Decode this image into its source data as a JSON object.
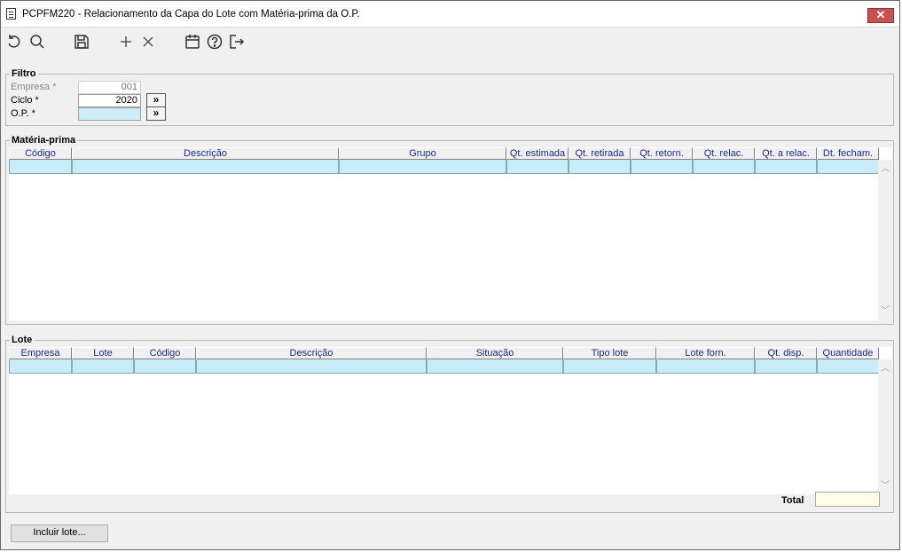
{
  "window": {
    "title": "PCPFM220 - Relacionamento da Capa do Lote com Matéria-prima da O.P.",
    "close_glyph": "✕"
  },
  "toolbar": {
    "icons": [
      "undo-icon",
      "search-icon",
      "save-icon",
      "add-icon",
      "delete-icon",
      "calendar-icon",
      "help-icon",
      "exit-icon"
    ]
  },
  "filtro": {
    "legend": "Filtro",
    "empresa_label": "Empresa *",
    "empresa_value": "001",
    "ciclo_label": "Ciclo *",
    "ciclo_value": "2020",
    "op_label": "O.P. *",
    "op_value": "",
    "zoom_glyph": "»"
  },
  "materia_prima": {
    "legend": "Matéria-prima",
    "columns": [
      "Código",
      "Descrição",
      "Grupo",
      "Qt. estimada",
      "Qt. retirada",
      "Qt. retorn.",
      "Qt. relac.",
      "Qt. a relac.",
      "Dt. fecham."
    ]
  },
  "lote": {
    "legend": "Lote",
    "columns": [
      "Empresa",
      "Lote",
      "Código",
      "Descrição",
      "Situação",
      "Tipo lote",
      "Lote forn.",
      "Qt. disp.",
      "Quantidade"
    ],
    "total_label": "Total",
    "total_value": ""
  },
  "footer": {
    "incluir_label": "Incluir lote..."
  },
  "colors": {
    "required_field": "#cdeef9",
    "header_text": "#1a2a8f",
    "total_field": "#fffde8",
    "close_button": "#c75050"
  }
}
